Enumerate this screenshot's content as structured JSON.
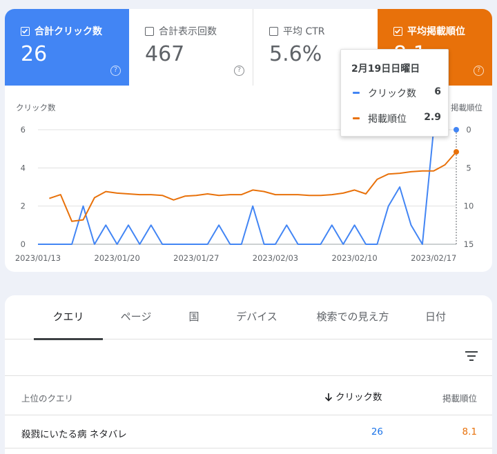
{
  "metrics": [
    {
      "label": "合計クリック数",
      "value": "26",
      "checked": true
    },
    {
      "label": "合計表示回数",
      "value": "467",
      "checked": false
    },
    {
      "label": "平均 CTR",
      "value": "5.6%",
      "checked": false
    },
    {
      "label": "平均掲載順位",
      "value": "8.1",
      "checked": true
    }
  ],
  "help_glyph": "?",
  "tooltip": {
    "date": "2月19日日曜日",
    "rows": [
      {
        "name": "クリック数",
        "value": "6"
      },
      {
        "name": "掲載順位",
        "value": "2.9"
      }
    ]
  },
  "colors": {
    "clicks": "#4285f4",
    "position": "#e8710a"
  },
  "chart_data": {
    "type": "line",
    "x": [
      "2023/01/13",
      "2023/01/14",
      "2023/01/15",
      "2023/01/16",
      "2023/01/17",
      "2023/01/18",
      "2023/01/19",
      "2023/01/20",
      "2023/01/21",
      "2023/01/22",
      "2023/01/23",
      "2023/01/24",
      "2023/01/25",
      "2023/01/26",
      "2023/01/27",
      "2023/01/28",
      "2023/01/29",
      "2023/01/30",
      "2023/01/31",
      "2023/02/01",
      "2023/02/02",
      "2023/02/03",
      "2023/02/04",
      "2023/02/05",
      "2023/02/06",
      "2023/02/07",
      "2023/02/08",
      "2023/02/09",
      "2023/02/10",
      "2023/02/11",
      "2023/02/12",
      "2023/02/13",
      "2023/02/14",
      "2023/02/15",
      "2023/02/16",
      "2023/02/17",
      "2023/02/18",
      "2023/02/19"
    ],
    "x_ticks": [
      "2023/01/13",
      "2023/01/20",
      "2023/01/27",
      "2023/02/03",
      "2023/02/10",
      "2023/02/17"
    ],
    "series": [
      {
        "name": "クリック数",
        "axis": "left",
        "values": [
          0,
          0,
          0,
          0,
          2,
          0,
          1,
          0,
          1,
          0,
          1,
          0,
          0,
          0,
          0,
          0,
          1,
          0,
          0,
          2,
          0,
          0,
          1,
          0,
          0,
          0,
          1,
          0,
          1,
          0,
          0,
          2,
          3,
          1,
          0,
          6
        ]
      },
      {
        "name": "掲載順位",
        "axis": "right",
        "values": [
          null,
          9.0,
          8.5,
          12.0,
          11.8,
          8.9,
          8.1,
          8.3,
          8.4,
          8.5,
          8.5,
          8.6,
          9.2,
          8.7,
          8.6,
          8.4,
          8.6,
          8.5,
          8.5,
          7.9,
          8.1,
          8.5,
          8.5,
          8.5,
          8.6,
          8.6,
          8.5,
          8.3,
          7.9,
          8.4,
          6.5,
          5.8,
          5.7,
          5.5,
          5.4,
          5.4,
          4.6,
          2.9
        ]
      }
    ],
    "ylabel_left": "クリック数",
    "ylabel_right": "掲載順位",
    "ylim_left": [
      0,
      6
    ],
    "yticks_left": [
      0,
      2,
      4,
      6
    ],
    "ylim_right": [
      15,
      0
    ],
    "yticks_right": [
      0,
      5,
      10,
      15
    ],
    "grid": true
  },
  "tabs": [
    "クエリ",
    "ページ",
    "国",
    "デバイス",
    "検索での見え方",
    "日付"
  ],
  "table": {
    "header_query": "上位のクエリ",
    "header_clicks": "クリック数",
    "header_position": "掲載順位",
    "rows": [
      {
        "query": "殺戮にいたる病 ネタバレ",
        "clicks": "26",
        "position": "8.1"
      }
    ]
  }
}
